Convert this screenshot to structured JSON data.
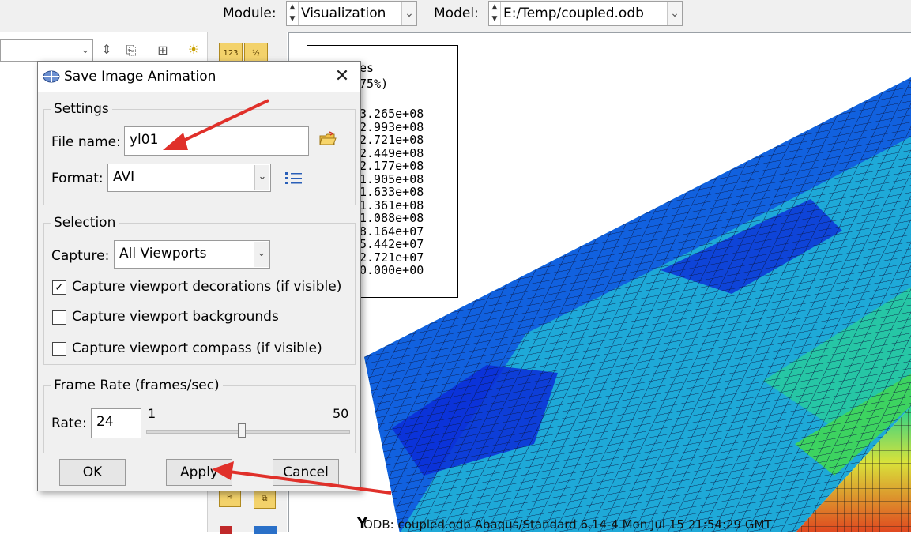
{
  "topbar": {
    "module_label": "Module:",
    "module_value": "Visualization",
    "model_label": "Model:",
    "model_value": "E:/Temp/coupled.odb"
  },
  "viewport": {
    "legend_lines": [
      "es",
      "75%)"
    ],
    "legend_values": [
      "3.265e+08",
      "2.993e+08",
      "2.721e+08",
      "2.449e+08",
      "2.177e+08",
      "1.905e+08",
      "1.633e+08",
      "1.361e+08",
      "1.088e+08",
      "8.164e+07",
      "5.442e+07",
      "2.721e+07",
      "0.000e+00"
    ],
    "axis_label": "Y",
    "status_text": "ODB: coupled.odb    Abaqus/Standard 6.14-4    Mon Jul 15 21:54:29 GMT"
  },
  "dialog": {
    "title": "Save Image Animation",
    "close_glyph": "✕",
    "settings": {
      "title": "Settings",
      "file_name_label": "File name:",
      "file_name_value": "yl01",
      "format_label": "Format:",
      "format_value": "AVI"
    },
    "selection": {
      "title": "Selection",
      "capture_label": "Capture:",
      "capture_value": "All Viewports",
      "checkboxes": [
        {
          "label": "Capture viewport decorations (if visible)",
          "checked": true
        },
        {
          "label": "Capture viewport backgrounds",
          "checked": false
        },
        {
          "label": "Capture viewport compass (if visible)",
          "checked": false
        }
      ]
    },
    "frame_rate": {
      "title": "Frame Rate (frames/sec)",
      "rate_label": "Rate:",
      "rate_value": "24",
      "slider_min": "1",
      "slider_max": "50"
    },
    "buttons": {
      "ok": "OK",
      "apply": "Apply",
      "cancel": "Cancel"
    }
  },
  "colors": {
    "annotation_arrow": "#e0302a",
    "mesh_low": "#0a2bd8",
    "mesh_high": "#e8381c"
  }
}
